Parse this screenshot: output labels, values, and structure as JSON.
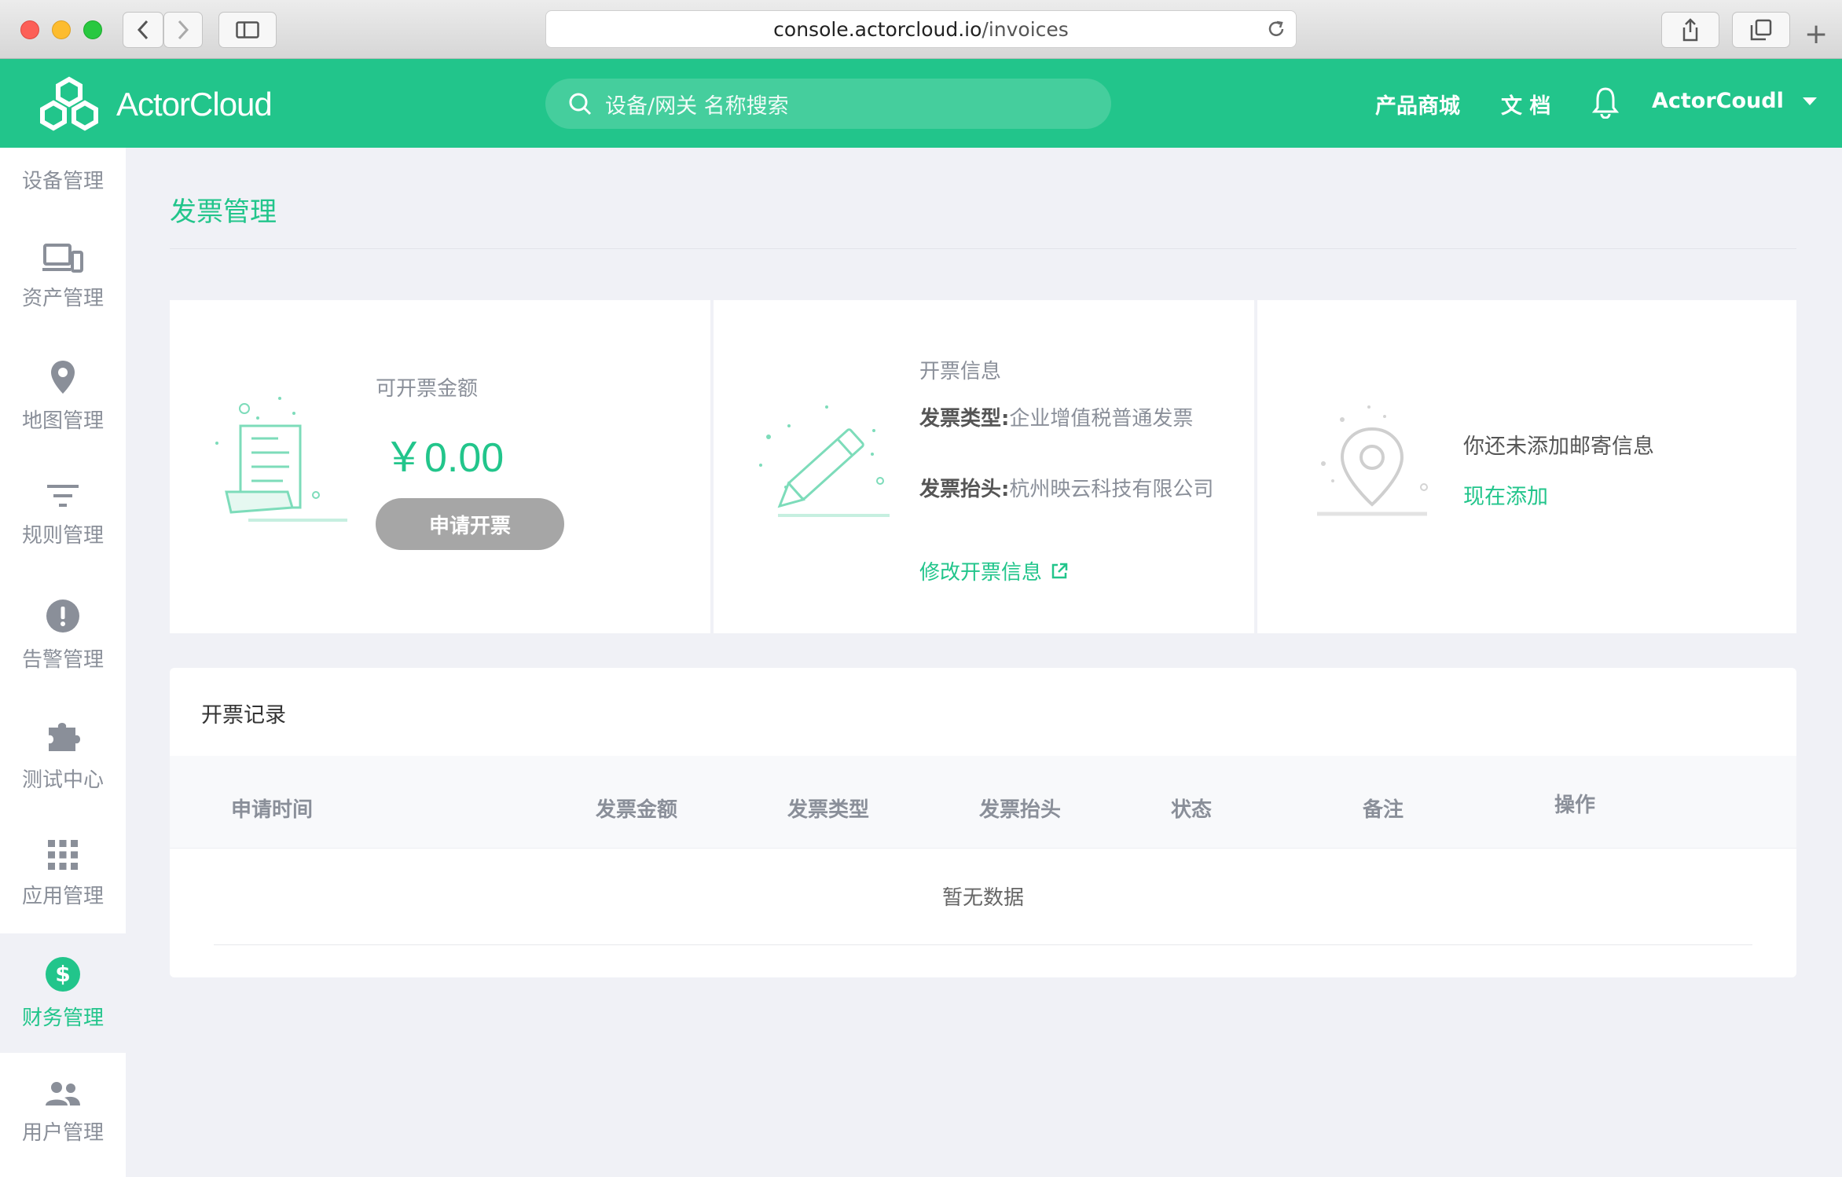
{
  "browser": {
    "url_host": "console.actorcloud.io",
    "url_path": "/invoices"
  },
  "header": {
    "brand": "ActorCloud",
    "search_placeholder": "设备/网关 名称搜索",
    "links": [
      "产品商城",
      "文 档"
    ],
    "user": "ActorCoudl"
  },
  "sidebar": {
    "items": [
      {
        "label": "设备管理",
        "icon": "device-icon"
      },
      {
        "label": "资产管理",
        "icon": "assets-icon"
      },
      {
        "label": "地图管理",
        "icon": "map-pin-icon"
      },
      {
        "label": "规则管理",
        "icon": "filter-icon"
      },
      {
        "label": "告警管理",
        "icon": "alert-icon"
      },
      {
        "label": "测试中心",
        "icon": "puzzle-icon"
      },
      {
        "label": "应用管理",
        "icon": "grid-icon"
      },
      {
        "label": "财务管理",
        "icon": "dollar-icon",
        "active": true
      },
      {
        "label": "用户管理",
        "icon": "users-icon"
      }
    ]
  },
  "page": {
    "title": "发票管理"
  },
  "amount_card": {
    "label": "可开票金额",
    "amount": "￥0.00",
    "button": "申请开票"
  },
  "invoice_info_card": {
    "title": "开票信息",
    "type_label": "发票类型:",
    "type_value": "企业增值税普通发票",
    "header_label": "发票抬头:",
    "header_value": "杭州映云科技有限公司",
    "edit_link": "修改开票信息"
  },
  "mail_card": {
    "message": "你还未添加邮寄信息",
    "add_link": "现在添加"
  },
  "records": {
    "title": "开票记录",
    "columns": [
      "申请时间",
      "发票金额",
      "发票类型",
      "发票抬头",
      "状态",
      "备注",
      "操作"
    ],
    "empty_text": "暂无数据"
  },
  "colors": {
    "brand_green": "#22c58b",
    "background": "#f0f1f6",
    "muted_text": "#8a8f99"
  }
}
